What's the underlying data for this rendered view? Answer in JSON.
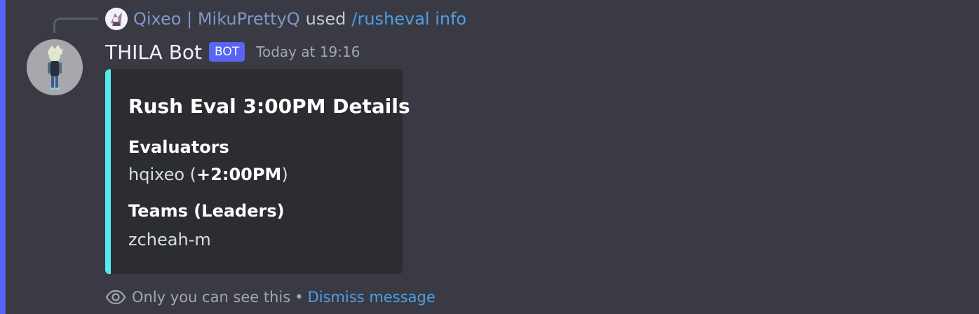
{
  "reply": {
    "username": "Qixeo | MikuPrettyQ",
    "used_text": "used",
    "command": "/rusheval info"
  },
  "message": {
    "bot_name": "THILA Bot",
    "bot_tag": "BOT",
    "timestamp": "Today at 19:16"
  },
  "embed": {
    "accent_color": "#55eaf0",
    "title": "Rush Eval 3:00PM Details",
    "fields": [
      {
        "name": "Evaluators",
        "value_prefix": "hqixeo (",
        "value_bold": "+2:00PM",
        "value_suffix": ")"
      },
      {
        "name": "Teams (Leaders)",
        "value": "zcheah-m"
      }
    ]
  },
  "ephemeral": {
    "notice": "Only you can see this",
    "separator": "•",
    "dismiss_label": "Dismiss message",
    "icon": "eye-icon"
  },
  "colors": {
    "background": "#393a43",
    "mention_bar": "#5865f2",
    "link": "#4f9ee8"
  }
}
